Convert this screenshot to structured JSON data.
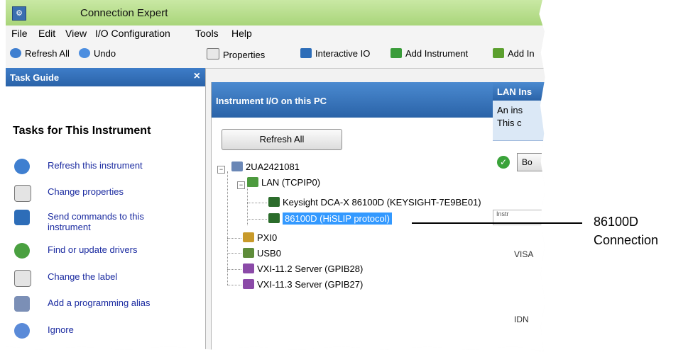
{
  "window": {
    "title": "Connection Expert"
  },
  "menu": [
    "File",
    "Edit",
    "View",
    "I/O Configuration",
    "Tools",
    "Help"
  ],
  "toolbar": {
    "refresh_all": "Refresh All",
    "undo": "Undo",
    "properties": "Properties",
    "interactive_io": "Interactive IO",
    "add_instrument": "Add Instrument",
    "add_clipped": "Add In"
  },
  "task_guide": {
    "header": "Task Guide",
    "close": "×",
    "title": "Tasks for This Instrument",
    "items": [
      {
        "label": "Refresh this instrument",
        "icon": "refresh-icon"
      },
      {
        "label": "Change properties",
        "icon": "edit-icon"
      },
      {
        "label": "Send commands to this instrument",
        "icon": "terminal-icon"
      },
      {
        "label": "Find or update drivers",
        "icon": "download-icon"
      },
      {
        "label": "Change the label",
        "icon": "edit-icon"
      },
      {
        "label": "Add a programming alias",
        "icon": "alias-icon"
      },
      {
        "label": "Ignore",
        "icon": "ignore-icon"
      }
    ]
  },
  "instrument_io": {
    "header": "Instrument I/O on this PC",
    "refresh_button": "Refresh All",
    "tree": {
      "pc": "2UA2421081",
      "lan": "LAN (TCPIP0)",
      "keysight": "Keysight DCA-X 86100D (KEYSIGHT-7E9BE01)",
      "hislip": "86100D (HiSLIP protocol)",
      "pxi": "PXI0",
      "usb": "USB0",
      "vxi2": "VXI-11.2 Server (GPIB28)",
      "vxi3": "VXI-11.3 Server (GPIB27)"
    }
  },
  "right_panel": {
    "header": "LAN Ins",
    "info_line1": "An ins",
    "info_line2": "This c",
    "ok_button": "Bo",
    "tab_text": "Instr",
    "visa_label": "VISA",
    "idn_label": "IDN"
  },
  "callout": {
    "line1": "86100D",
    "line2": "Connection"
  },
  "colors": {
    "title_green": "#a9d57a",
    "panel_blue": "#2a63a8",
    "selection": "#3399ff",
    "link_blue": "#1a2aa0"
  }
}
